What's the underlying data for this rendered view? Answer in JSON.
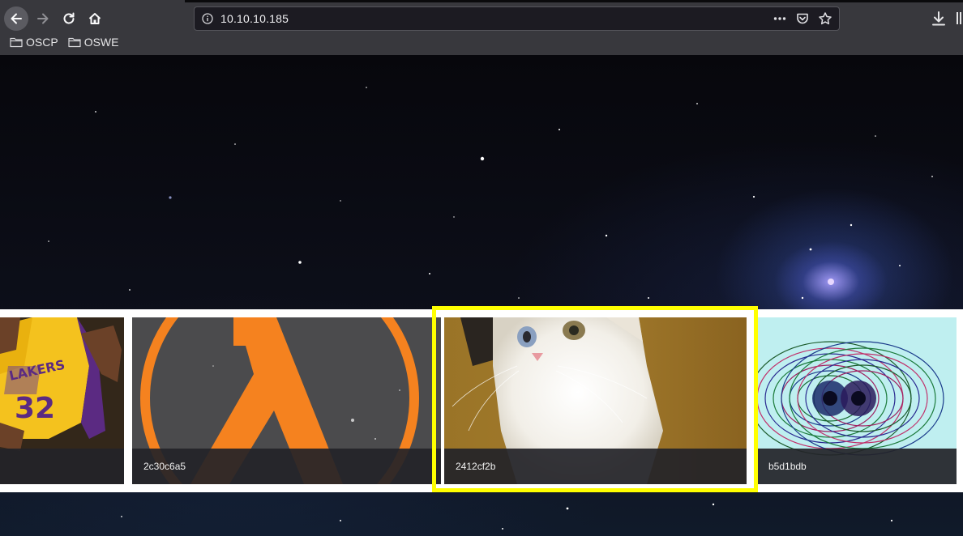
{
  "browser": {
    "url": "10.10.10.185",
    "bookmarks": [
      {
        "label": "OSCP"
      },
      {
        "label": "OSWE"
      }
    ]
  },
  "gallery": {
    "tiles": [
      {
        "caption": "",
        "image": "basketball-player-lakers-32"
      },
      {
        "caption": "2c30c6a5",
        "image": "half-life-lambda-logo"
      },
      {
        "caption": "2412cf2b",
        "image": "white-kitten",
        "selected": true
      },
      {
        "caption": "b5d1bdb",
        "image": "psychedelic-spiral-eyes"
      }
    ]
  },
  "colors": {
    "selection_border": "#ffff00",
    "lambda_orange": "#f5821f"
  }
}
